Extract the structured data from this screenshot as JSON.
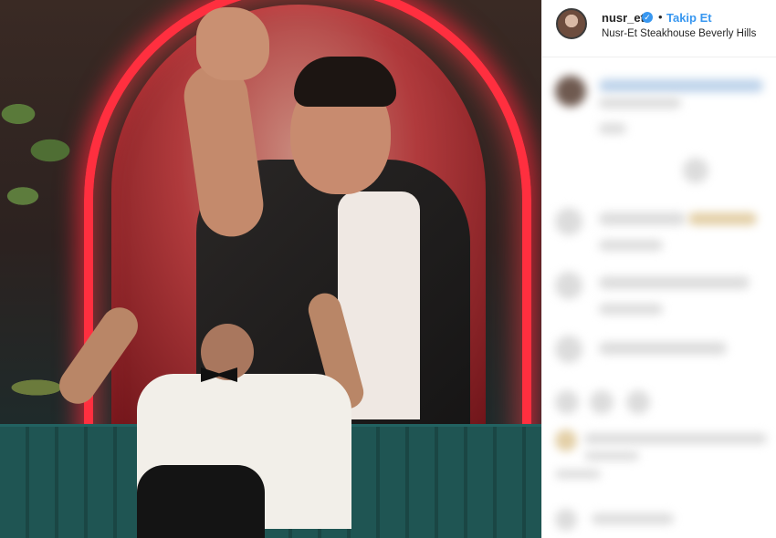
{
  "post": {
    "image_alt": "",
    "account": {
      "username": "nusr_et",
      "verified_icon": "check-badge-icon",
      "separator": "•",
      "follow_label": "Takip Et",
      "location": "Nusr-Et Steakhouse Beverly Hills"
    }
  },
  "colors": {
    "link": "#3897f0",
    "text": "#262626",
    "neon": "#ff2f3f"
  }
}
